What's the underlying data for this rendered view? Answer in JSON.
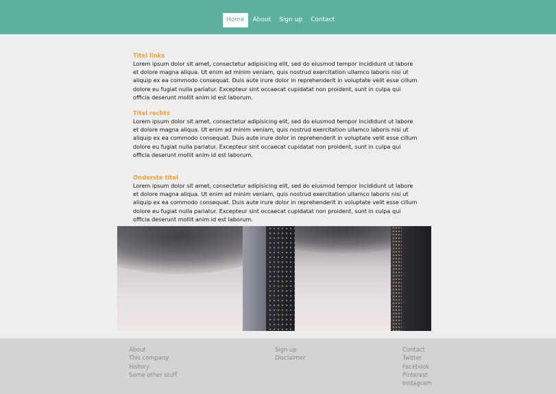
{
  "nav": {
    "items": [
      {
        "label": "Home"
      },
      {
        "label": "About"
      },
      {
        "label": "Sign up"
      },
      {
        "label": "Contact"
      }
    ]
  },
  "sections": [
    {
      "title": "Titel links",
      "body": "Lorem ipsum dolor sit amet, consectetur adipisicing elit, sed do eiusmod tempor incididunt ut labore et dolore magna aliqua. Ut enim ad minim veniam, quis nostrud exercitation ullamco laboris nisi ut aliquip ex ea commodo consequat. Duis aute irure dolor in reprehenderit in voluptate velit esse cillum dolore eu fugiat nulla pariatur. Excepteur sint occaecat cupidatat non proident, sunt in culpa qui officia deserunt mollit anim id est laborum."
    },
    {
      "title": "Titel rechts",
      "body": "Lorem ipsum dolor sit amet, consectetur adipisicing elit, sed do eiusmod tempor incididunt ut labore et dolore magna aliqua. Ut enim ad minim veniam, quis nostrud exercitation ullamco laboris nisi ut aliquip ex ea commodo consequat. Duis aute irure dolor in reprehenderit in voluptate velit esse cillum dolore eu fugiat nulla pariatur. Excepteur sint occaecat cupidatat non proident, sunt in culpa qui officia deserunt mollit anim id est laborum."
    },
    {
      "title": "Onderste titel",
      "body": "Lorem ipsum dolor sit amet, consectetur adipisicing elit, sed do eiusmod tempor incididunt ut labore et dolore magna aliqua. Ut enim ad minim veniam, quis nostrud exercitation ullamco laboris nisi ut aliquip ex ea commodo consequat. Duis aute irure dolor in reprehenderit in voluptate velit esse cillum dolore eu fugiat nulla pariatur. Excepteur sint occaecat cupidatat non proident, sunt in culpa qui officia deserunt mollit anim id est laborum."
    }
  ],
  "footer": {
    "col1": [
      "About",
      "This company",
      "History",
      "Some other stuff"
    ],
    "col2": [
      "Sign up",
      "Disclaimer"
    ],
    "col3": [
      "Contact",
      "Twitter",
      "Facebook",
      "Pinterest",
      "Instagram"
    ]
  },
  "colors": {
    "header": "#5bb09e",
    "accent": "#f4a13a",
    "background": "#eeeeee",
    "footer": "#d3d3d3"
  }
}
